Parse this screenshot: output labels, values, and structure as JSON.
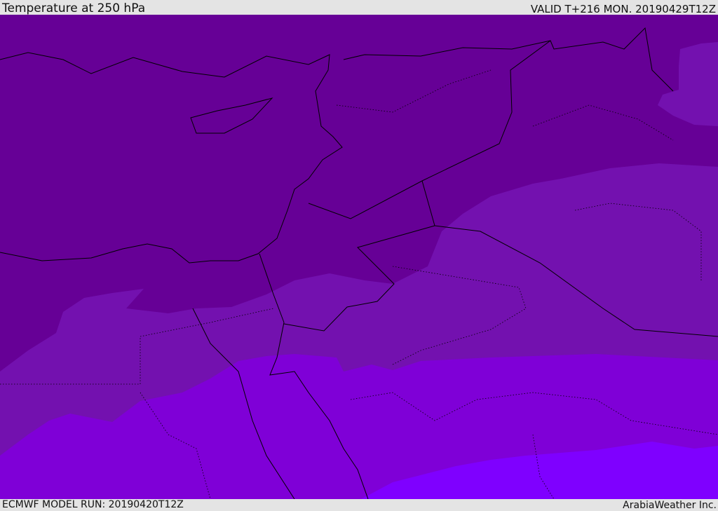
{
  "header": {
    "title": "Temperature at 250 hPa",
    "valid": "VALID T+216 MON. 20190429T12Z"
  },
  "footer": {
    "model_run": "ECMWF MODEL RUN: 20190420T12Z",
    "brand": "ArabiaWeather Inc."
  },
  "map": {
    "band_colors": [
      "#660096",
      "#7311AF",
      "#7F00D7",
      "#7F00FF"
    ],
    "line_color": "#000000"
  }
}
